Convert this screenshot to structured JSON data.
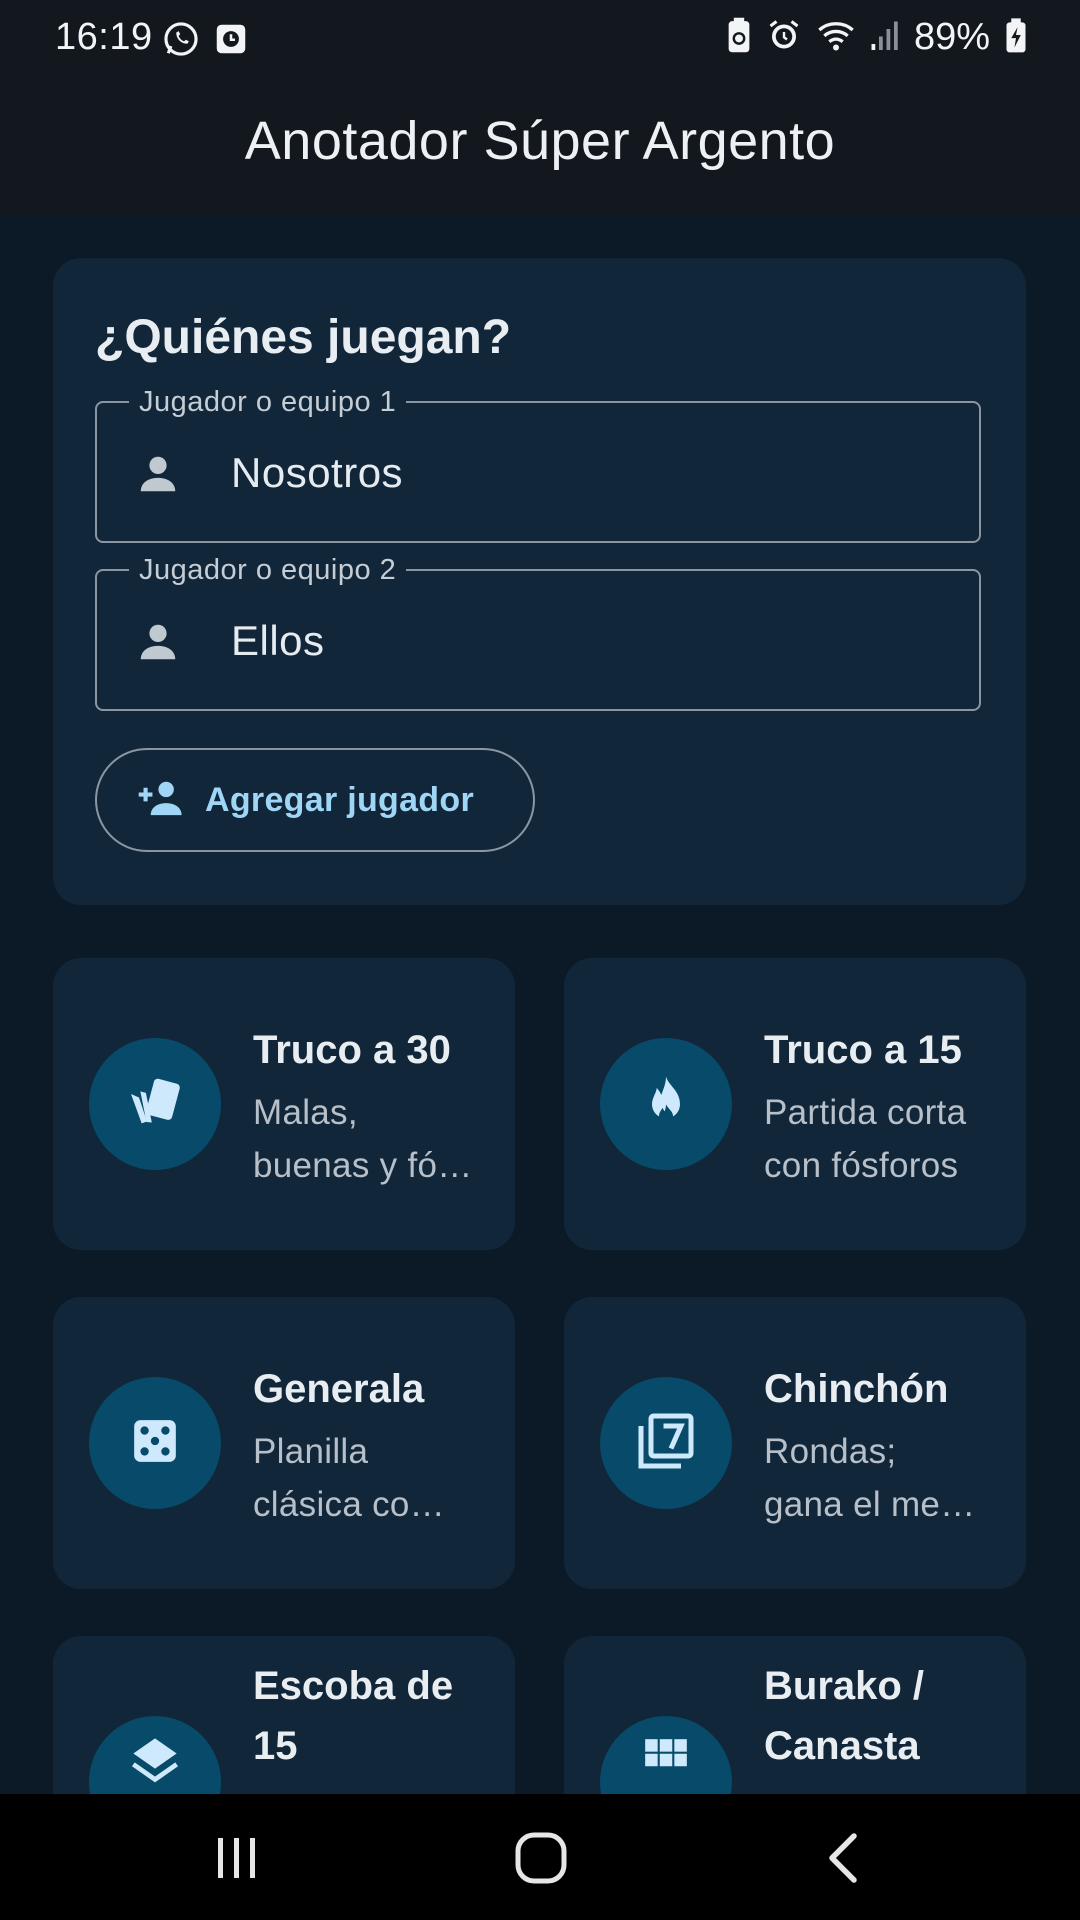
{
  "status_bar": {
    "time": "16:19",
    "battery_text": "89%",
    "left_icons": [
      "whatsapp-icon",
      "clock-notification-icon"
    ],
    "right_icons": [
      "battery-saver-icon",
      "alarm-icon",
      "wifi-icon",
      "signal-icon",
      "battery-charging-icon"
    ]
  },
  "app_bar": {
    "title": "Anotador Súper Argento"
  },
  "players": {
    "heading": "¿Quiénes juegan?",
    "fields": [
      {
        "label": "Jugador o equipo 1",
        "value": "Nosotros",
        "icon": "person-icon"
      },
      {
        "label": "Jugador o equipo 2",
        "value": "Ellos",
        "icon": "person-icon"
      }
    ],
    "add_button": {
      "label": "Agregar jugador",
      "icon": "person-add-icon"
    }
  },
  "games": [
    {
      "title": "Truco a 30",
      "desc_lines": [
        "Malas,",
        "buenas y fó…"
      ],
      "icon": "cards-icon"
    },
    {
      "title": "Truco a 15",
      "desc_lines": [
        "Partida corta",
        "con fósforos"
      ],
      "icon": "fire-icon"
    },
    {
      "title": "Generala",
      "desc_lines": [
        "Planilla",
        "clásica co…"
      ],
      "icon": "dice-icon"
    },
    {
      "title": "Chinchón",
      "desc_lines": [
        "Rondas;",
        "gana el me…"
      ],
      "icon": "filter-7-icon"
    },
    {
      "title_lines": [
        "Escoba de",
        "15"
      ],
      "icon": "layers-icon"
    },
    {
      "title_lines": [
        "Burako /",
        "Canasta"
      ],
      "icon": "grid-icon"
    }
  ],
  "colors": {
    "background": "#0b1a26",
    "card": "#12263a",
    "accent": "#9fd5f5",
    "icon_circle": "#074a6a"
  },
  "nav_bar": {
    "buttons": [
      "recent-apps-icon",
      "home-icon",
      "back-icon"
    ]
  }
}
